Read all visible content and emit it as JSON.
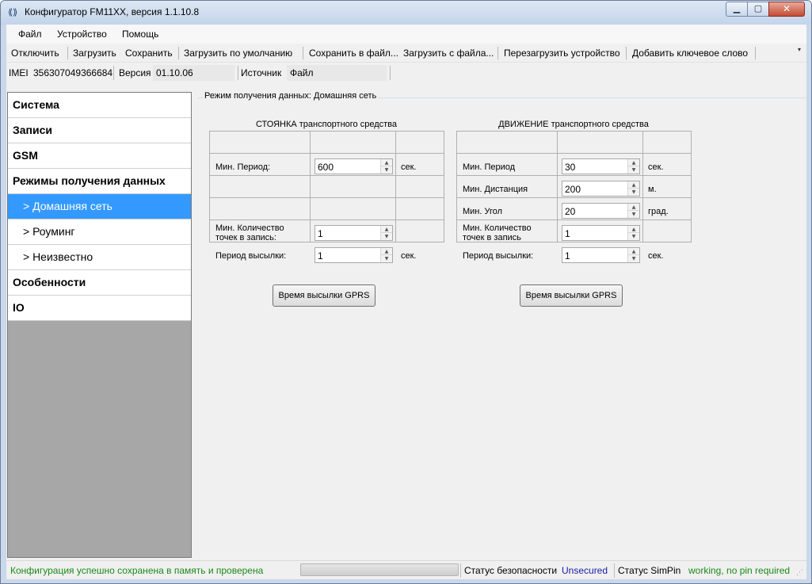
{
  "window": {
    "title": "Конфигуратор FM11XX, версия 1.1.10.8",
    "icon": "app-connector-icon",
    "minimize_glyph": "▁",
    "maximize_glyph": "▢",
    "close_glyph": "✕"
  },
  "menubar": {
    "items": [
      {
        "label": "Файл"
      },
      {
        "label": "Устройство"
      },
      {
        "label": "Помощь"
      }
    ]
  },
  "toolbar": {
    "items": [
      {
        "label": "Отключить"
      },
      {
        "label": "Загрузить"
      },
      {
        "label": "Сохранить"
      },
      {
        "label": "Загрузить по умолчанию"
      },
      {
        "label": "Сохранить в файл..."
      },
      {
        "label": "Загрузить с файла..."
      },
      {
        "label": "Перезагрузить устройство"
      },
      {
        "label": "Добавить ключевое слово"
      }
    ],
    "overflow_glyph": "▾"
  },
  "infobar": {
    "imei_label": "IMEI",
    "imei_value": "356307049366684",
    "version_label": "Версия",
    "version_value": "01.10.06",
    "source_label": "Источник",
    "source_value": "Файл"
  },
  "sidebar": {
    "items": [
      {
        "label": "Система",
        "kind": "category"
      },
      {
        "label": "Записи",
        "kind": "category"
      },
      {
        "label": "GSM",
        "kind": "category"
      },
      {
        "label": "Режимы получения данных",
        "kind": "category"
      },
      {
        "label": "> Домашняя сеть",
        "kind": "sub",
        "selected": true
      },
      {
        "label": "> Роуминг",
        "kind": "sub"
      },
      {
        "label": "> Неизвестно",
        "kind": "sub"
      },
      {
        "label": "Особенности",
        "kind": "category"
      },
      {
        "label": "IO",
        "kind": "category"
      }
    ],
    "selected_color": "#3399ff"
  },
  "main": {
    "group_title": "Режим получения данных: Домашняя сеть",
    "stop": {
      "title": "СТОЯНКА транспортного средства",
      "min_period_label": "Мин. Период:",
      "min_period_value": "600",
      "min_period_unit": "сек.",
      "min_count_label": "Мин. Количество точек в запись:",
      "min_count_value": "1",
      "send_period_label": "Период высылки:",
      "send_period_value": "1",
      "send_period_unit": "сек.",
      "gprs_button": "Время высылки GPRS"
    },
    "move": {
      "title": "ДВИЖЕНИЕ транспортного средства",
      "min_period_label": "Мин. Период",
      "min_period_value": "30",
      "min_period_unit": "сек.",
      "min_distance_label": "Мин. Дистанция",
      "min_distance_value": "200",
      "min_distance_unit": "м.",
      "min_angle_label": "Мин. Угол",
      "min_angle_value": "20",
      "min_angle_unit": "град.",
      "min_count_label": "Мин. Количество точек в запись",
      "min_count_value": "1",
      "send_period_label": "Период высылки:",
      "send_period_value": "1",
      "send_period_unit": "сек.",
      "gprs_button": "Время высылки GPRS"
    }
  },
  "statusbar": {
    "message": "Конфигурация успешно сохранена в память и проверена",
    "message_color": "#1a8a1a",
    "security_label": "Статус безопасности",
    "security_value": "Unsecured",
    "security_color": "#1a1aa8",
    "simpin_label": "Статус SimPin",
    "simpin_value": "working, no pin required",
    "simpin_color": "#1a8a1a"
  },
  "spin_up_glyph": "▲",
  "spin_down_glyph": "▼",
  "grip_glyph": "⋰"
}
